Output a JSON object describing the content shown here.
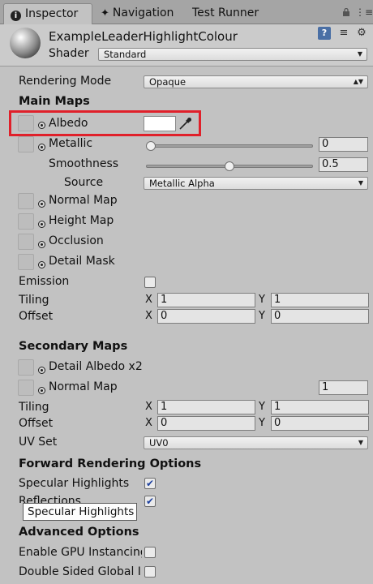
{
  "tabs": {
    "inspector": "Inspector",
    "navigation": "Navigation",
    "test_runner": "Test Runner"
  },
  "header": {
    "material_name": "ExampleLeaderHighlightColour",
    "shader_label": "Shader",
    "shader_value": "Standard"
  },
  "rendering": {
    "label": "Rendering Mode",
    "value": "Opaque"
  },
  "main_maps": {
    "title": "Main Maps",
    "albedo": "Albedo",
    "albedo_color": "#ffffff",
    "metallic": "Metallic",
    "metallic_value": "0",
    "metallic_fraction": 0,
    "smoothness": "Smoothness",
    "smoothness_value": "0.5",
    "smoothness_fraction": 0.5,
    "source": "Source",
    "source_value": "Metallic Alpha",
    "normal_map": "Normal Map",
    "height_map": "Height Map",
    "occlusion": "Occlusion",
    "detail_mask": "Detail Mask",
    "emission": "Emission",
    "tiling": "Tiling",
    "offset": "Offset",
    "tiling_x": "1",
    "tiling_y": "1",
    "offset_x": "0",
    "offset_y": "0"
  },
  "secondary_maps": {
    "title": "Secondary Maps",
    "detail_albedo": "Detail Albedo x2",
    "normal_map": "Normal Map",
    "normal_scale": "1",
    "tiling": "Tiling",
    "offset": "Offset",
    "tiling_x": "1",
    "tiling_y": "1",
    "offset_x": "0",
    "offset_y": "0",
    "uv_set": "UV Set",
    "uv_set_value": "UV0"
  },
  "axis": {
    "x": "X",
    "y": "Y"
  },
  "forward": {
    "title": "Forward Rendering Options",
    "specular": "Specular Highlights",
    "reflections": "Reflections",
    "tooltip": "Specular Highlights"
  },
  "advanced": {
    "title": "Advanced Options",
    "gpu_instancing": "Enable GPU Instancing",
    "double_sided": "Double Sided Global Illumination"
  },
  "colors": {
    "highlight": "#e0202a",
    "checkmark": "#1b3f9e"
  }
}
